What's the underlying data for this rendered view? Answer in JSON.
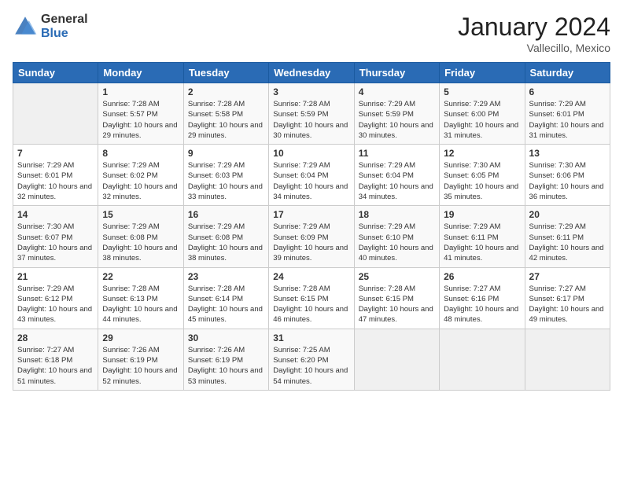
{
  "logo": {
    "general": "General",
    "blue": "Blue"
  },
  "header": {
    "month": "January 2024",
    "location": "Vallecillo, Mexico"
  },
  "weekdays": [
    "Sunday",
    "Monday",
    "Tuesday",
    "Wednesday",
    "Thursday",
    "Friday",
    "Saturday"
  ],
  "weeks": [
    [
      {
        "day": "",
        "sunrise": "",
        "sunset": "",
        "daylight": ""
      },
      {
        "day": "1",
        "sunrise": "Sunrise: 7:28 AM",
        "sunset": "Sunset: 5:57 PM",
        "daylight": "Daylight: 10 hours and 29 minutes."
      },
      {
        "day": "2",
        "sunrise": "Sunrise: 7:28 AM",
        "sunset": "Sunset: 5:58 PM",
        "daylight": "Daylight: 10 hours and 29 minutes."
      },
      {
        "day": "3",
        "sunrise": "Sunrise: 7:28 AM",
        "sunset": "Sunset: 5:59 PM",
        "daylight": "Daylight: 10 hours and 30 minutes."
      },
      {
        "day": "4",
        "sunrise": "Sunrise: 7:29 AM",
        "sunset": "Sunset: 5:59 PM",
        "daylight": "Daylight: 10 hours and 30 minutes."
      },
      {
        "day": "5",
        "sunrise": "Sunrise: 7:29 AM",
        "sunset": "Sunset: 6:00 PM",
        "daylight": "Daylight: 10 hours and 31 minutes."
      },
      {
        "day": "6",
        "sunrise": "Sunrise: 7:29 AM",
        "sunset": "Sunset: 6:01 PM",
        "daylight": "Daylight: 10 hours and 31 minutes."
      }
    ],
    [
      {
        "day": "7",
        "sunrise": "Sunrise: 7:29 AM",
        "sunset": "Sunset: 6:01 PM",
        "daylight": "Daylight: 10 hours and 32 minutes."
      },
      {
        "day": "8",
        "sunrise": "Sunrise: 7:29 AM",
        "sunset": "Sunset: 6:02 PM",
        "daylight": "Daylight: 10 hours and 32 minutes."
      },
      {
        "day": "9",
        "sunrise": "Sunrise: 7:29 AM",
        "sunset": "Sunset: 6:03 PM",
        "daylight": "Daylight: 10 hours and 33 minutes."
      },
      {
        "day": "10",
        "sunrise": "Sunrise: 7:29 AM",
        "sunset": "Sunset: 6:04 PM",
        "daylight": "Daylight: 10 hours and 34 minutes."
      },
      {
        "day": "11",
        "sunrise": "Sunrise: 7:29 AM",
        "sunset": "Sunset: 6:04 PM",
        "daylight": "Daylight: 10 hours and 34 minutes."
      },
      {
        "day": "12",
        "sunrise": "Sunrise: 7:30 AM",
        "sunset": "Sunset: 6:05 PM",
        "daylight": "Daylight: 10 hours and 35 minutes."
      },
      {
        "day": "13",
        "sunrise": "Sunrise: 7:30 AM",
        "sunset": "Sunset: 6:06 PM",
        "daylight": "Daylight: 10 hours and 36 minutes."
      }
    ],
    [
      {
        "day": "14",
        "sunrise": "Sunrise: 7:30 AM",
        "sunset": "Sunset: 6:07 PM",
        "daylight": "Daylight: 10 hours and 37 minutes."
      },
      {
        "day": "15",
        "sunrise": "Sunrise: 7:29 AM",
        "sunset": "Sunset: 6:08 PM",
        "daylight": "Daylight: 10 hours and 38 minutes."
      },
      {
        "day": "16",
        "sunrise": "Sunrise: 7:29 AM",
        "sunset": "Sunset: 6:08 PM",
        "daylight": "Daylight: 10 hours and 38 minutes."
      },
      {
        "day": "17",
        "sunrise": "Sunrise: 7:29 AM",
        "sunset": "Sunset: 6:09 PM",
        "daylight": "Daylight: 10 hours and 39 minutes."
      },
      {
        "day": "18",
        "sunrise": "Sunrise: 7:29 AM",
        "sunset": "Sunset: 6:10 PM",
        "daylight": "Daylight: 10 hours and 40 minutes."
      },
      {
        "day": "19",
        "sunrise": "Sunrise: 7:29 AM",
        "sunset": "Sunset: 6:11 PM",
        "daylight": "Daylight: 10 hours and 41 minutes."
      },
      {
        "day": "20",
        "sunrise": "Sunrise: 7:29 AM",
        "sunset": "Sunset: 6:11 PM",
        "daylight": "Daylight: 10 hours and 42 minutes."
      }
    ],
    [
      {
        "day": "21",
        "sunrise": "Sunrise: 7:29 AM",
        "sunset": "Sunset: 6:12 PM",
        "daylight": "Daylight: 10 hours and 43 minutes."
      },
      {
        "day": "22",
        "sunrise": "Sunrise: 7:28 AM",
        "sunset": "Sunset: 6:13 PM",
        "daylight": "Daylight: 10 hours and 44 minutes."
      },
      {
        "day": "23",
        "sunrise": "Sunrise: 7:28 AM",
        "sunset": "Sunset: 6:14 PM",
        "daylight": "Daylight: 10 hours and 45 minutes."
      },
      {
        "day": "24",
        "sunrise": "Sunrise: 7:28 AM",
        "sunset": "Sunset: 6:15 PM",
        "daylight": "Daylight: 10 hours and 46 minutes."
      },
      {
        "day": "25",
        "sunrise": "Sunrise: 7:28 AM",
        "sunset": "Sunset: 6:15 PM",
        "daylight": "Daylight: 10 hours and 47 minutes."
      },
      {
        "day": "26",
        "sunrise": "Sunrise: 7:27 AM",
        "sunset": "Sunset: 6:16 PM",
        "daylight": "Daylight: 10 hours and 48 minutes."
      },
      {
        "day": "27",
        "sunrise": "Sunrise: 7:27 AM",
        "sunset": "Sunset: 6:17 PM",
        "daylight": "Daylight: 10 hours and 49 minutes."
      }
    ],
    [
      {
        "day": "28",
        "sunrise": "Sunrise: 7:27 AM",
        "sunset": "Sunset: 6:18 PM",
        "daylight": "Daylight: 10 hours and 51 minutes."
      },
      {
        "day": "29",
        "sunrise": "Sunrise: 7:26 AM",
        "sunset": "Sunset: 6:19 PM",
        "daylight": "Daylight: 10 hours and 52 minutes."
      },
      {
        "day": "30",
        "sunrise": "Sunrise: 7:26 AM",
        "sunset": "Sunset: 6:19 PM",
        "daylight": "Daylight: 10 hours and 53 minutes."
      },
      {
        "day": "31",
        "sunrise": "Sunrise: 7:25 AM",
        "sunset": "Sunset: 6:20 PM",
        "daylight": "Daylight: 10 hours and 54 minutes."
      },
      {
        "day": "",
        "sunrise": "",
        "sunset": "",
        "daylight": ""
      },
      {
        "day": "",
        "sunrise": "",
        "sunset": "",
        "daylight": ""
      },
      {
        "day": "",
        "sunrise": "",
        "sunset": "",
        "daylight": ""
      }
    ]
  ]
}
